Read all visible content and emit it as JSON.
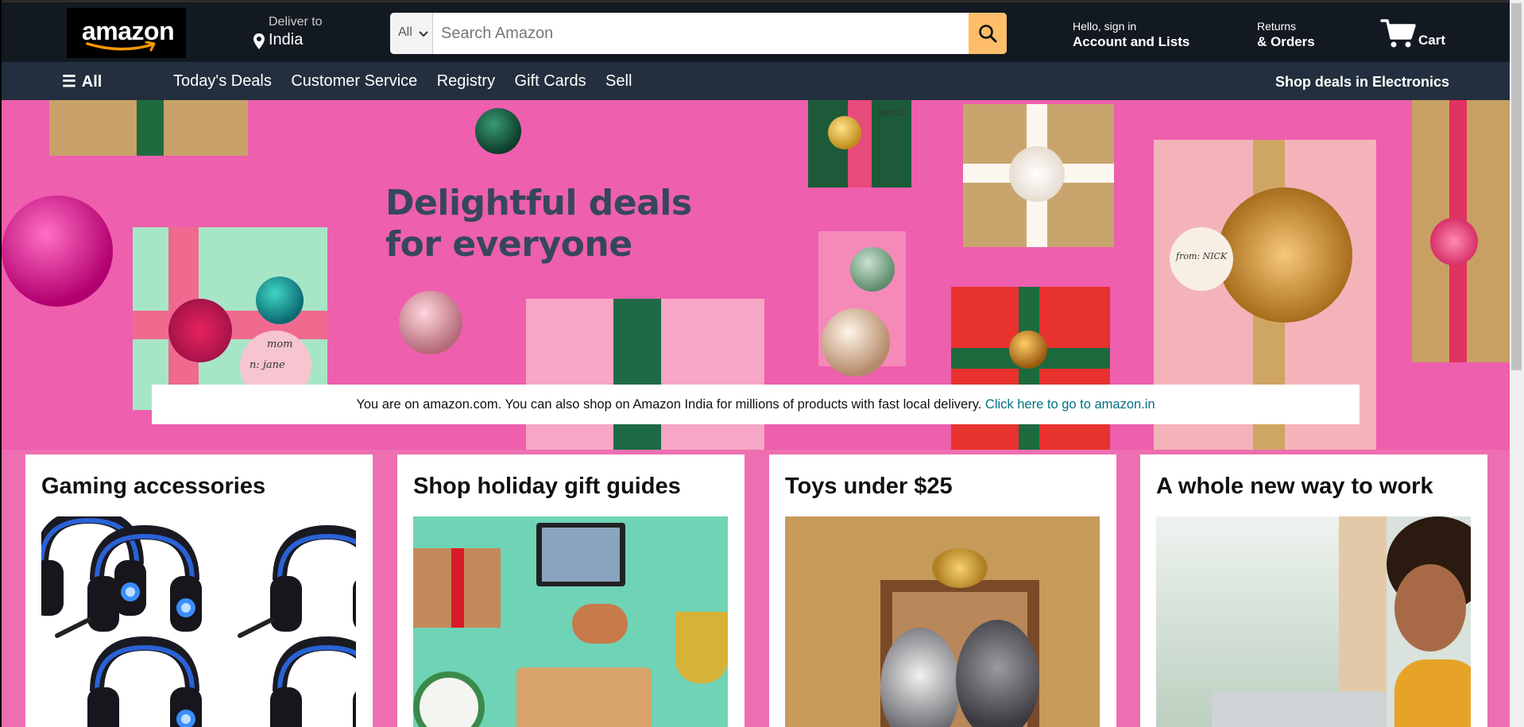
{
  "header": {
    "logo_text": "amazon",
    "deliver_label": "Deliver to",
    "deliver_location": "India",
    "search": {
      "category": "All",
      "placeholder": "Search Amazon"
    },
    "account_greeting": "Hello, sign in",
    "account_label": "Account and Lists",
    "returns_line1": "Returns",
    "returns_line2": "& Orders",
    "cart_label": "Cart"
  },
  "nav": {
    "all_label": "All",
    "links": [
      "Today's Deals",
      "Customer Service",
      "Registry",
      "Gift Cards",
      "Sell"
    ],
    "promo": "Shop deals in Electronics"
  },
  "hero": {
    "title_line1": "Delightful deals",
    "title_line2": "for everyone",
    "gift_tag_1": "mom",
    "gift_tag_2": "n: jane",
    "gift_tag_3": "sarah",
    "gift_tag_4": "from: NICK"
  },
  "notice": {
    "text": "You are on amazon.com. You can also shop on Amazon India for millions of products with fast local delivery.",
    "link": "Click here to go to amazon.in"
  },
  "cards": [
    {
      "title": "Gaming accessories"
    },
    {
      "title": "Shop holiday gift guides"
    },
    {
      "title": "Toys under $25"
    },
    {
      "title": "A whole new way to work"
    }
  ],
  "colors": {
    "header_bg": "#131921",
    "nav_bg": "#232f3e",
    "search_button": "#febd69",
    "hero_pink": "#ee5fae",
    "link_teal": "#007185"
  },
  "icons": [
    "amazon-smile-logo",
    "location-pin-icon",
    "chevron-down-icon",
    "search-icon",
    "cart-icon",
    "hamburger-menu-icon"
  ]
}
